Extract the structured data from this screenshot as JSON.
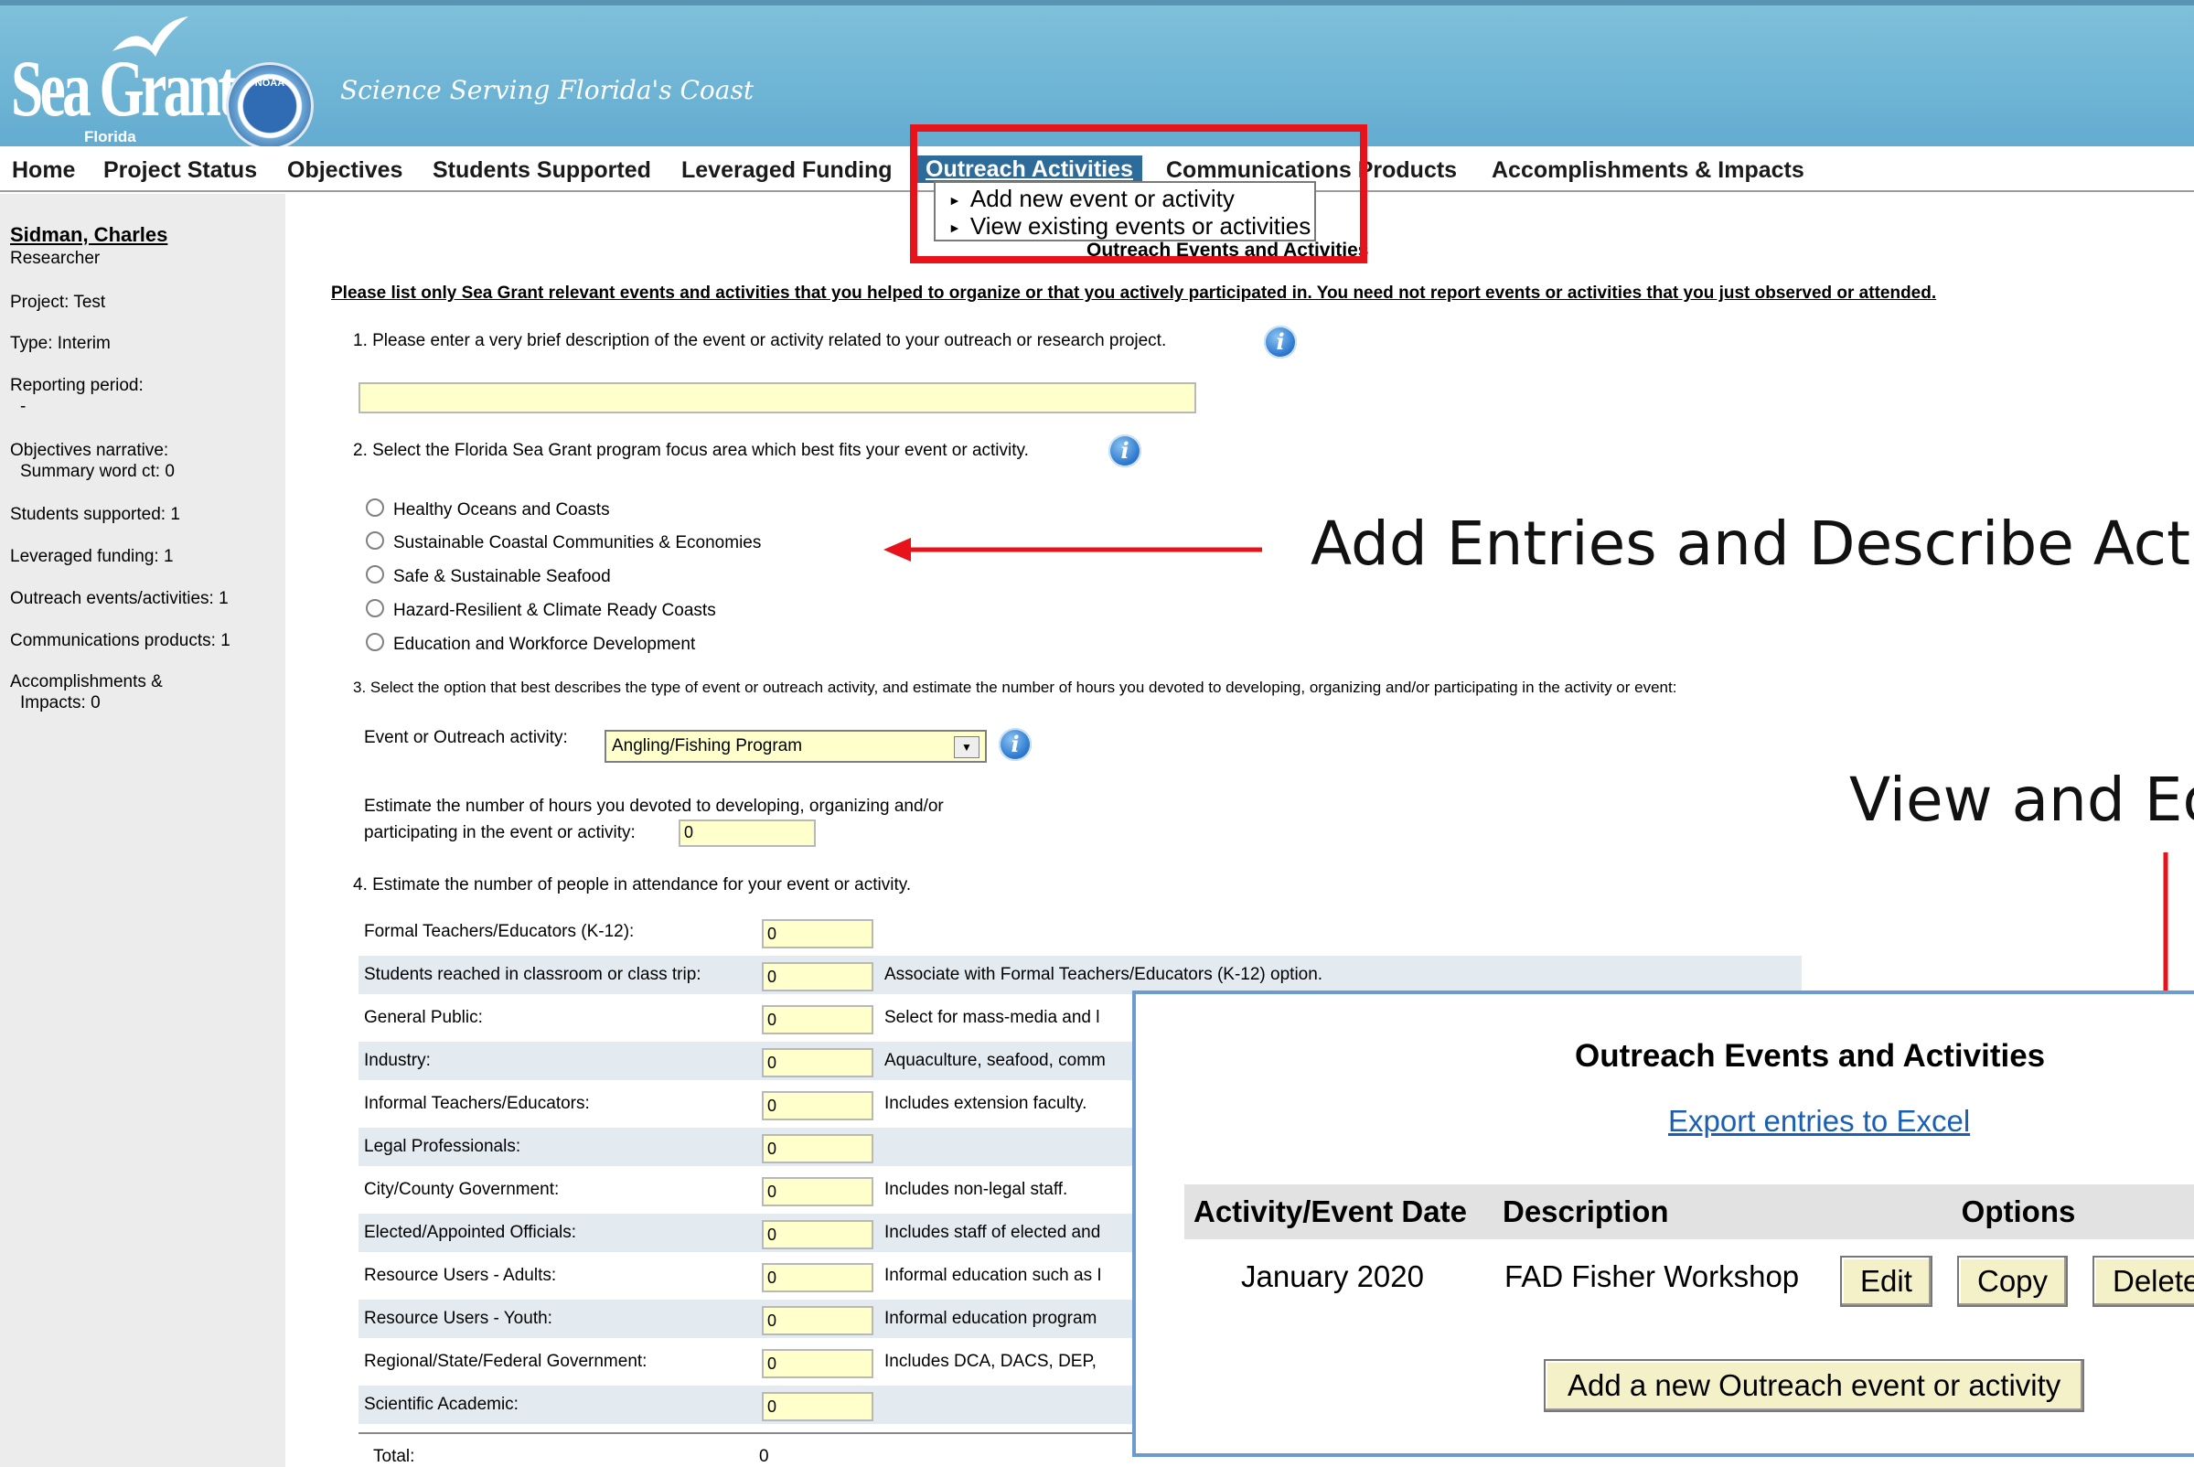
{
  "header": {
    "logo_text": "Sea Grant",
    "logo_sub": "Florida",
    "noaa_label": "NOAA",
    "tagline": "Science Serving Florida's Coast"
  },
  "menu": {
    "items": [
      "Home",
      "Project Status",
      "Objectives",
      "Students Supported",
      "Leveraged Funding",
      "Outreach Activities",
      "Communications Products",
      "Accomplishments & Impacts"
    ],
    "active": "Outreach Activities",
    "dropdown": [
      "Add new event or activity",
      "View existing events or activities"
    ]
  },
  "sidebar": {
    "name": "Sidman, Charles",
    "role": "Researcher",
    "project": "Project: Test",
    "type": "Type: Interim",
    "reporting_period": "Reporting period:",
    "reporting_value": "-",
    "objectives_narrative": "Objectives narrative:",
    "summary_word_ct": "Summary word ct: 0",
    "students_supported": "Students supported: 1",
    "leveraged_funding": "Leveraged funding: 1",
    "outreach": "Outreach events/activities: 1",
    "communications": "Communications products: 1",
    "accomplishments": "Accomplishments &",
    "impacts": "Impacts: 0"
  },
  "form": {
    "page_title": "Outreach Events and Activities",
    "instruction": "Please list only Sea Grant relevant events and activities that you helped to organize or that you actively participated in. You need not report events or activities that you just observed or attended.",
    "q1": "1. Please enter a very brief description of the event or activity related to your outreach or research project.",
    "q1_value": "",
    "q2": "2. Select the Florida Sea Grant program focus area which best fits your event or activity.",
    "focus_areas": [
      "Healthy Oceans and Coasts",
      "Sustainable Coastal Communities & Economies",
      "Safe & Sustainable Seafood",
      "Hazard-Resilient & Climate Ready Coasts",
      "Education and Workforce Development"
    ],
    "q3": "3. Select the option that best describes the type of event or outreach activity, and estimate the number of hours you devoted to developing, organizing and/or participating in the activity or event:",
    "activity_label": "Event or Outreach activity:",
    "activity_value": "Angling/Fishing Program",
    "hours_label_1": "Estimate the number of hours you devoted to developing, organizing and/or",
    "hours_label_2": "participating in the event or activity:",
    "hours_value": "0",
    "q4": "4. Estimate the number of people in attendance for your event or activity.",
    "attendance": [
      {
        "label": "Formal Teachers/Educators (K-12):",
        "value": "0",
        "note": ""
      },
      {
        "label": "Students reached in classroom or class trip:",
        "value": "0",
        "note": "Associate with Formal Teachers/Educators (K-12) option."
      },
      {
        "label": "General Public:",
        "value": "0",
        "note": "Select for mass-media and l"
      },
      {
        "label": "Industry:",
        "value": "0",
        "note": "Aquaculture, seafood, comm"
      },
      {
        "label": "Informal Teachers/Educators:",
        "value": "0",
        "note": "Includes extension faculty."
      },
      {
        "label": "Legal Professionals:",
        "value": "0",
        "note": ""
      },
      {
        "label": "City/County Government:",
        "value": "0",
        "note": "Includes non-legal staff."
      },
      {
        "label": "Elected/Appointed Officials:",
        "value": "0",
        "note": "Includes staff of elected and"
      },
      {
        "label": "Resource Users - Adults:",
        "value": "0",
        "note": "Informal education such as I"
      },
      {
        "label": "Resource Users - Youth:",
        "value": "0",
        "note": "Informal education program"
      },
      {
        "label": "Regional/State/Federal Government:",
        "value": "0",
        "note": "Includes DCA, DACS, DEP,"
      },
      {
        "label": "Scientific Academic:",
        "value": "0",
        "note": ""
      }
    ],
    "total_label": "Total:",
    "total_value": "0"
  },
  "annotations": {
    "add_entries": "Add Entries and Describe Activ",
    "view_edit": "View and Ed"
  },
  "overlay": {
    "title": "Outreach Events and Activities",
    "export_link": "Export entries to Excel",
    "columns": [
      "Activity/Event Date",
      "Description",
      "Options"
    ],
    "rows": [
      {
        "date": "January 2020",
        "description": "FAD Fisher Workshop"
      }
    ],
    "buttons": [
      "Edit",
      "Copy",
      "Delete"
    ],
    "add_button": "Add a new Outreach event or activity"
  },
  "colors": {
    "banner": "#6cb4d6",
    "active_menu": "#2d6b9a",
    "highlight": "#e8121a",
    "input_fill": "#ffffcc",
    "overlay_border": "#6b9bd1",
    "link": "#1a5fb4"
  }
}
